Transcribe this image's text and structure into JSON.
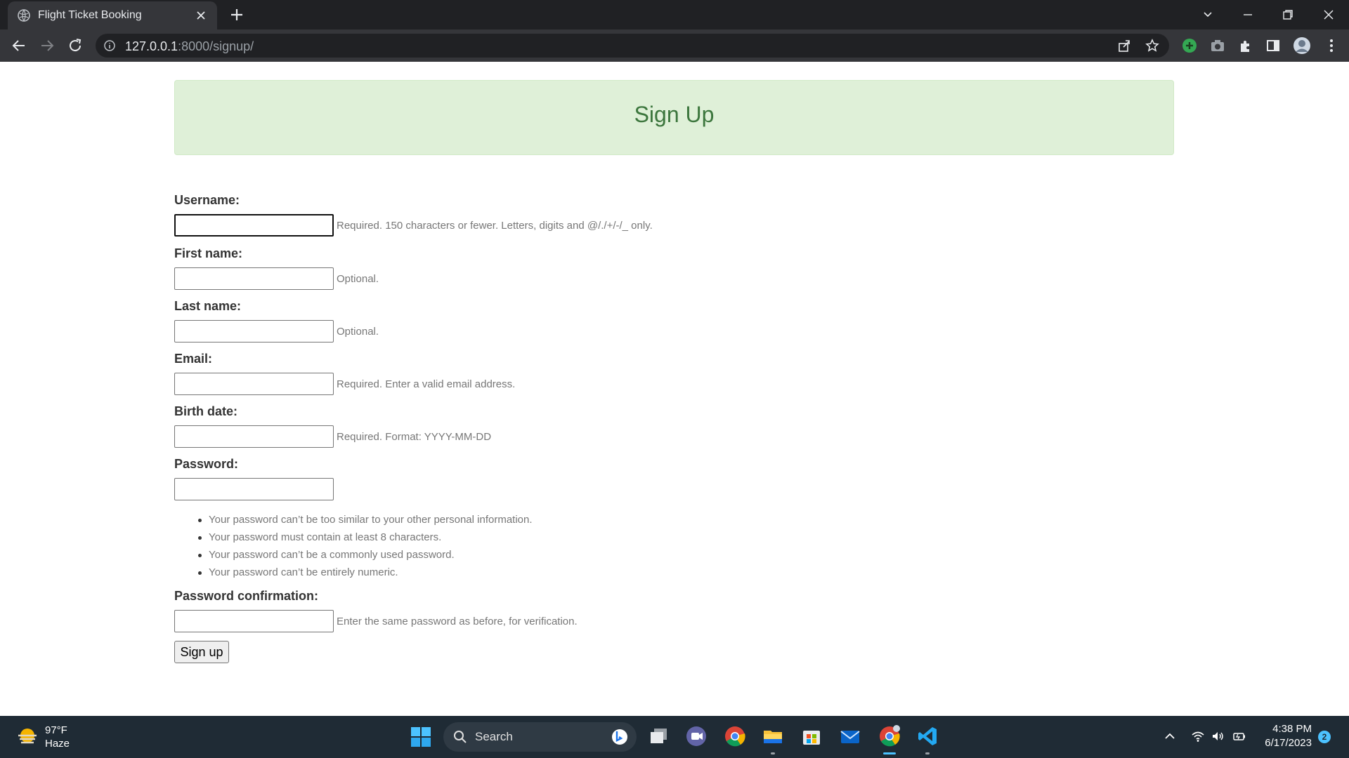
{
  "browser": {
    "tab_title": "Flight Ticket Booking",
    "url_host": "127.0.0.1",
    "url_rest": ":8000/signup/"
  },
  "page": {
    "title": "Sign Up",
    "fields": [
      {
        "label": "Username:",
        "help": "Required. 150 characters or fewer. Letters, digits and @/./+/-/_ only.",
        "value": ""
      },
      {
        "label": "First name:",
        "help": "Optional.",
        "value": ""
      },
      {
        "label": "Last name:",
        "help": "Optional.",
        "value": ""
      },
      {
        "label": "Email:",
        "help": "Required. Enter a valid email address.",
        "value": ""
      },
      {
        "label": "Birth date:",
        "help": "Required. Format: YYYY-MM-DD",
        "value": ""
      },
      {
        "label": "Password:",
        "help": "",
        "value": ""
      },
      {
        "label": "Password confirmation:",
        "help": "Enter the same password as before, for verification.",
        "value": ""
      }
    ],
    "password_rules": [
      "Your password can’t be too similar to your other personal information.",
      "Your password must contain at least 8 characters.",
      "Your password can’t be a commonly used password.",
      "Your password can’t be entirely numeric."
    ],
    "submit_label": "Sign up"
  },
  "taskbar": {
    "weather_temp": "97°F",
    "weather_desc": "Haze",
    "search_label": "Search",
    "time": "4:38 PM",
    "date": "6/17/2023",
    "notification_count": "2"
  },
  "colors": {
    "banner_bg": "#dff0d8",
    "banner_text": "#3c763d",
    "chrome_dark": "#202124",
    "taskbar": "#1f2b35"
  }
}
